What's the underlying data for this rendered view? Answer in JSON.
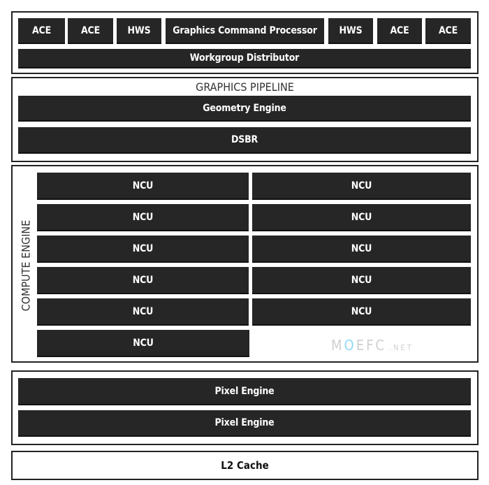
{
  "front_end": {
    "units": [
      "ACE",
      "ACE",
      "HWS",
      "Graphics Command Processor",
      "HWS",
      "ACE",
      "ACE"
    ],
    "distributor": "Workgroup Distributor"
  },
  "graphics_pipeline": {
    "title": "GRAPHICS PIPELINE",
    "blocks": [
      "Geometry Engine",
      "DSBR"
    ]
  },
  "compute_engine": {
    "title": "COMPUTE ENGINE",
    "left": [
      "NCU",
      "NCU",
      "NCU",
      "NCU",
      "NCU",
      "NCU"
    ],
    "right": [
      "NCU",
      "NCU",
      "NCU",
      "NCU",
      "NCU"
    ]
  },
  "pixel": {
    "blocks": [
      "Pixel Engine",
      "Pixel Engine"
    ]
  },
  "l2": "L2 Cache",
  "watermark": {
    "m": "M",
    "o": "O",
    "rest": "EFC",
    "net": ".NET"
  },
  "colors": {
    "block": "#262626",
    "watermark_accent": "#8fd9ef"
  }
}
